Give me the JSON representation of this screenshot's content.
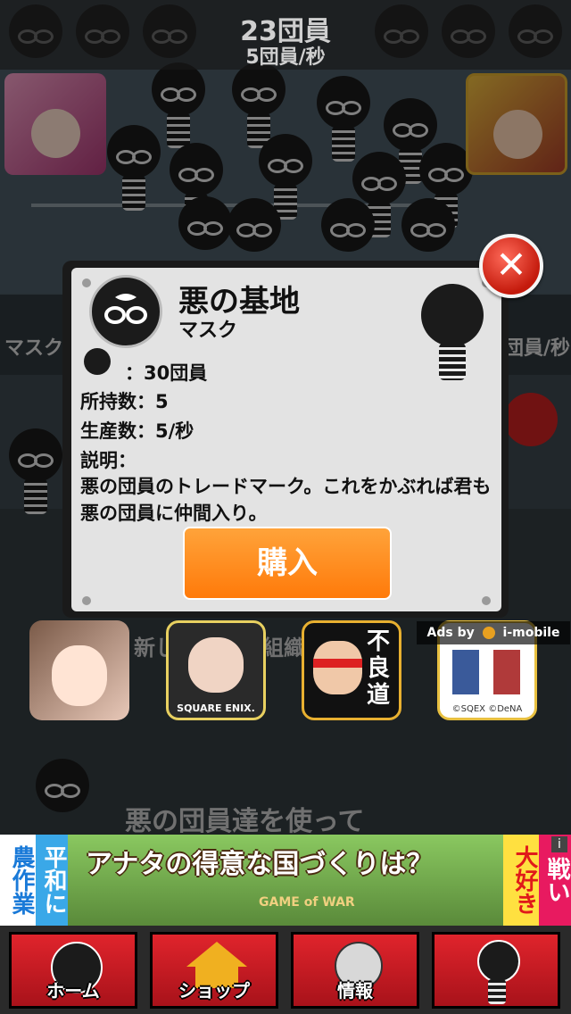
{
  "header": {
    "member_count": "23団員",
    "member_rate": "5団員/秒"
  },
  "modal": {
    "title": "悪の基地",
    "item_name": "マスク",
    "cost_label": "：30団員",
    "owned_label": "所持数：5",
    "production_label": "生産数：5/秒",
    "description_label": "説明：",
    "description_text": "悪の団員のトレードマーク。これをかぶれば君も悪の団員に仲間入り。",
    "buy_button": "購入",
    "close_icon": "close-x-icon"
  },
  "background_text": {
    "left_label": "マスク",
    "right_label": "団員/秒",
    "middle_label": "新しい　悪の組織",
    "bottom_label": "悪の団員達を使って"
  },
  "ads": {
    "ads_by": "Ads by",
    "provider": "i-mobile",
    "icons": [
      {
        "name": "anime-girl-game-ad"
      },
      {
        "name": "square-enix-game-ad",
        "caption": "SQUARE ENIX."
      },
      {
        "name": "furyodo-game-ad",
        "caption": "不良道"
      },
      {
        "name": "pixel-rpg-game-ad",
        "caption": "©SQEX ©DeNA"
      }
    ]
  },
  "banner": {
    "left_text": "農作業",
    "left_text2": "平和に",
    "main_text": "アナタの得意な国づくりは？",
    "right_text": "大好き",
    "right_text2": "戦い",
    "logo": "GAME of WAR",
    "info_icon": "i"
  },
  "nav": {
    "items": [
      {
        "label": "ホーム",
        "icon": "mask-icon"
      },
      {
        "label": "ショップ",
        "icon": "house-icon"
      },
      {
        "label": "情報",
        "icon": "info-icon"
      },
      {
        "label": "",
        "icon": "member-icon"
      }
    ]
  },
  "colors": {
    "buy_orange": "#ff8c1a",
    "nav_red": "#d21e26",
    "close_red": "#d8281a"
  }
}
